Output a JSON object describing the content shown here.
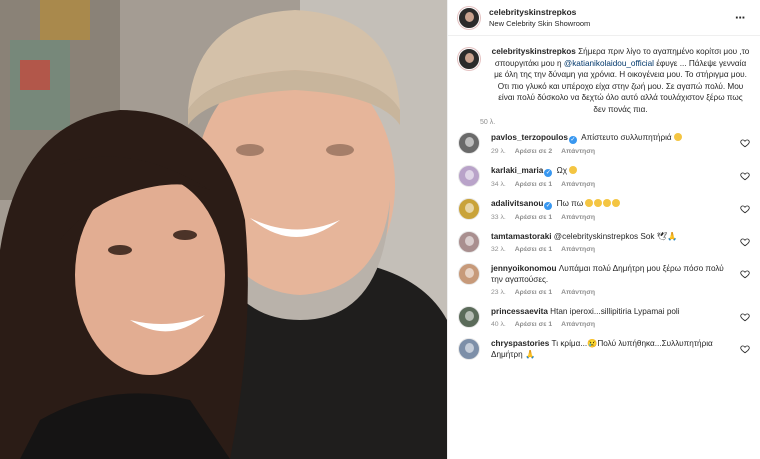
{
  "header": {
    "username": "celebrityskinstrepkos",
    "location": "New Celebrity Skin Showroom",
    "more_icon": "ellipsis-icon"
  },
  "caption": {
    "username": "celebrityskinstrepkos",
    "text_before": " Σήμερα πριν λίγο το αγαπημένο κορίτσι μου ,το σπουργιτάκι μου η ",
    "mention": "@katianikolaidou_official",
    "text_after": " έφυγε ... Πάλεψε γενναία με όλη της την δύναμη για χρόνια. Η οικογένεια μου. Το στήριγμα μου. Οτι πιο γλυκό και υπέροχο είχα στην ζωή μου. Σε αγαπώ πολύ. Μου είναι πολύ δύσκολο να δεχτώ όλο αυτό αλλά τουλάχιστον ξέρω πως δεν πονάς πια.",
    "time": "50 λ."
  },
  "comments": [
    {
      "username": "pavlos_terzopoulos",
      "verified": true,
      "text": " Απίστευτο συλλυπητήριά ",
      "time": "29 λ.",
      "likes": "Αρέσει σε 2",
      "reply": "Απάντηση",
      "avatar_color": "#6a6a6a"
    },
    {
      "username": "karlaki_maria",
      "verified": true,
      "text": " Ωχ ",
      "time": "34 λ.",
      "likes": "Αρέσει σε 1",
      "reply": "Απάντηση",
      "avatar_color": "#b9a3c9"
    },
    {
      "username": "adalivitsanou",
      "verified": true,
      "text": " Πω πω ",
      "time": "33 λ.",
      "likes": "Αρέσει σε 1",
      "reply": "Απάντηση",
      "avatar_color": "#c9a33a"
    },
    {
      "username": "tamtamastoraki",
      "verified": false,
      "text": " @celebrityskinstrepkos Sok 🕊🙏",
      "time": "32 λ.",
      "likes": "Αρέσει σε 1",
      "reply": "Απάντηση",
      "avatar_color": "#a98f8f"
    },
    {
      "username": "jennyoikonomou",
      "verified": false,
      "text": " Λυπάμαι πολύ Δημήτρη μου ξέρω πόσο πολύ την αγαπούσες.",
      "time": "23 λ.",
      "likes": "Αρέσει σε 1",
      "reply": "Απάντηση",
      "avatar_color": "#c79a7a"
    },
    {
      "username": "princessaevita",
      "verified": false,
      "text": " Htan iperoxi...sillipitiria Lypamai poli",
      "time": "40 λ.",
      "likes": "Αρέσει σε 1",
      "reply": "Απάντηση",
      "avatar_color": "#5b6b5a"
    },
    {
      "username": "chryspastories",
      "verified": false,
      "text": " Τι κρίμα...😢Πολύ λυπήθηκα...Συλλυπητήρια Δημήτρη 🙏",
      "time": "",
      "likes": "",
      "reply": "",
      "avatar_color": "#7d8fa8"
    }
  ],
  "icons": {
    "heart": "heart-icon",
    "verified": "verified-badge-icon"
  }
}
